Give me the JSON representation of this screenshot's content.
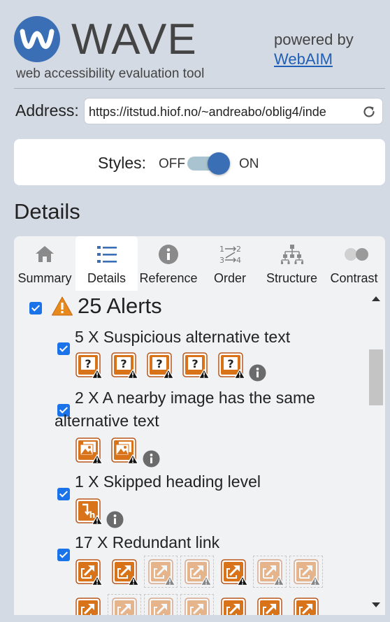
{
  "header": {
    "logo_letter": "W",
    "logo_word": "WAVE",
    "tagline": "web accessibility evaluation tool",
    "powered_by": "powered by",
    "webaim_link": "WebAIM"
  },
  "address": {
    "label": "Address:",
    "value": "https://itstud.hiof.no/~andreabo/oblig4/inde"
  },
  "styles": {
    "label": "Styles:",
    "off": "OFF",
    "on": "ON",
    "state": "on"
  },
  "section_title": "Details",
  "tabs": [
    {
      "label": "Summary",
      "icon": "home-icon"
    },
    {
      "label": "Details",
      "icon": "list-icon"
    },
    {
      "label": "Reference",
      "icon": "info-icon"
    },
    {
      "label": "Order",
      "icon": "order-icon"
    },
    {
      "label": "Structure",
      "icon": "structure-icon"
    },
    {
      "label": "Contrast",
      "icon": "contrast-icon"
    }
  ],
  "active_tab": "Details",
  "alerts": {
    "title": "25 Alerts",
    "categories": [
      {
        "line1": "5 X Suspicious alternative text",
        "line2": "",
        "icon": "suspicious-alt-icon",
        "count": 5
      },
      {
        "line1": "2 X A nearby image has the same",
        "line2": "alternative text",
        "icon": "same-alt-image-icon",
        "count": 2
      },
      {
        "line1": "1 X Skipped heading level",
        "line2": "",
        "icon": "skipped-heading-icon",
        "count": 1
      },
      {
        "line1": "17 X Redundant link",
        "line2": "",
        "icon": "redundant-link-icon",
        "count": 17
      }
    ]
  },
  "colors": {
    "brand_blue": "#3a6fb6",
    "alert_orange": "#d9731a",
    "link_blue": "#1f5fb5",
    "checkbox_blue": "#1a73e8"
  }
}
